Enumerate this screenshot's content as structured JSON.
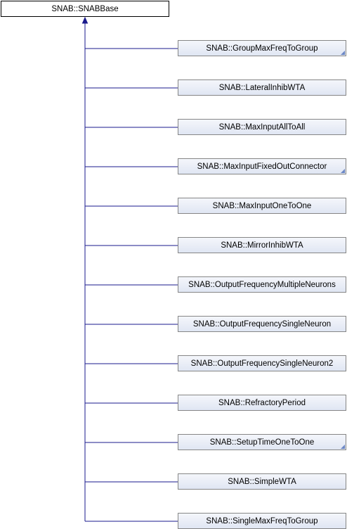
{
  "diagram": {
    "base_class": "SNAB::SNABBase",
    "derived_classes": [
      {
        "name": "SNAB::GroupMaxFreqToGroup",
        "has_more": true
      },
      {
        "name": "SNAB::LateralInhibWTA",
        "has_more": false
      },
      {
        "name": "SNAB::MaxInputAllToAll",
        "has_more": false
      },
      {
        "name": "SNAB::MaxInputFixedOutConnector",
        "has_more": true
      },
      {
        "name": "SNAB::MaxInputOneToOne",
        "has_more": false
      },
      {
        "name": "SNAB::MirrorInhibWTA",
        "has_more": false
      },
      {
        "name": "SNAB::OutputFrequencyMultipleNeurons",
        "has_more": false
      },
      {
        "name": "SNAB::OutputFrequencySingleNeuron",
        "has_more": false
      },
      {
        "name": "SNAB::OutputFrequencySingleNeuron2",
        "has_more": false
      },
      {
        "name": "SNAB::RefractoryPeriod",
        "has_more": false
      },
      {
        "name": "SNAB::SetupTimeOneToOne",
        "has_more": true
      },
      {
        "name": "SNAB::SimpleWTA",
        "has_more": false
      },
      {
        "name": "SNAB::SingleMaxFreqToGroup",
        "has_more": false
      }
    ],
    "colors": {
      "edge": "#1a1a8c",
      "node_border": "#868686",
      "fold_marker": "#6b86c4"
    }
  }
}
